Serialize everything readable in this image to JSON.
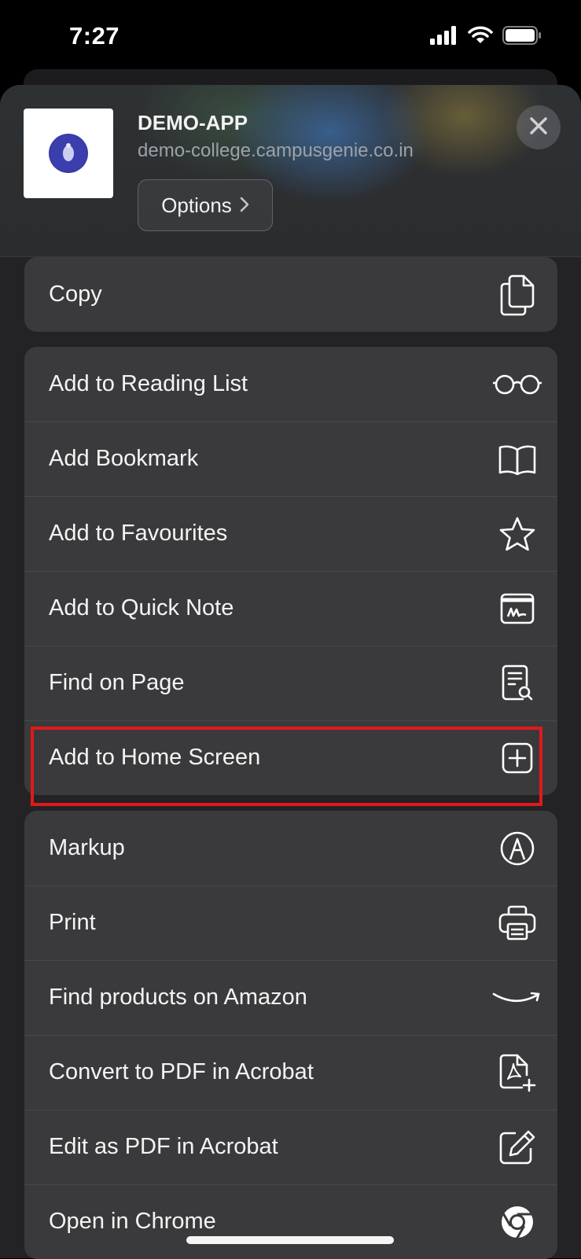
{
  "status_bar": {
    "time": "7:27"
  },
  "header": {
    "title": "DEMO-APP",
    "url": "demo-college.campusgenie.co.in",
    "options_label": "Options"
  },
  "groups": [
    {
      "items": [
        {
          "label": "Copy",
          "icon": "copy-icon"
        }
      ]
    },
    {
      "items": [
        {
          "label": "Add to Reading List",
          "icon": "glasses-icon"
        },
        {
          "label": "Add Bookmark",
          "icon": "book-icon"
        },
        {
          "label": "Add to Favourites",
          "icon": "star-icon"
        },
        {
          "label": "Add to Quick Note",
          "icon": "quick-note-icon"
        },
        {
          "label": "Find on Page",
          "icon": "find-on-page-icon"
        },
        {
          "label": "Add to Home Screen",
          "icon": "add-square-icon"
        }
      ]
    },
    {
      "items": [
        {
          "label": "Markup",
          "icon": "markup-icon"
        },
        {
          "label": "Print",
          "icon": "printer-icon"
        },
        {
          "label": "Find products on Amazon",
          "icon": "amazon-icon"
        },
        {
          "label": "Convert to PDF in Acrobat",
          "icon": "acrobat-pdf-icon"
        },
        {
          "label": "Edit as PDF in Acrobat",
          "icon": "edit-pdf-icon"
        },
        {
          "label": "Open in Chrome",
          "icon": "chrome-icon"
        }
      ]
    }
  ],
  "colors": {
    "sheet": "#232325",
    "group": "#3a3a3c",
    "highlight": "#e0191b"
  }
}
